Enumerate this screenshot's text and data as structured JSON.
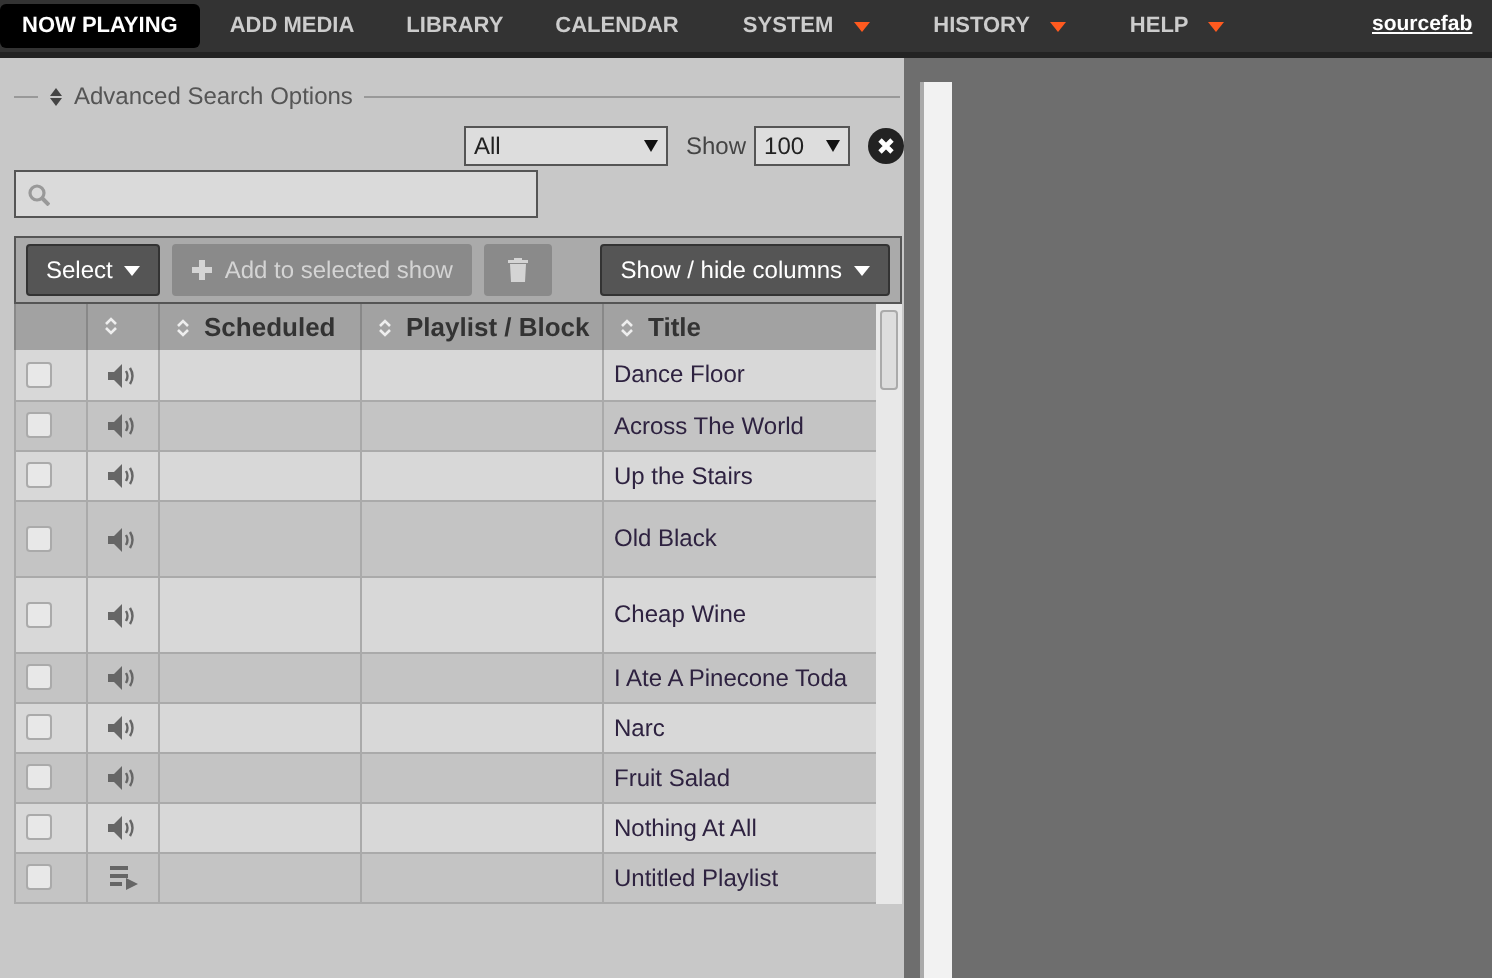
{
  "nav": {
    "items": [
      {
        "label": "NOW PLAYING",
        "selected": true,
        "dropdown": false
      },
      {
        "label": "ADD MEDIA",
        "selected": false,
        "dropdown": false
      },
      {
        "label": "LIBRARY",
        "selected": false,
        "dropdown": false
      },
      {
        "label": "CALENDAR",
        "selected": false,
        "dropdown": false
      },
      {
        "label": "SYSTEM",
        "selected": false,
        "dropdown": true
      },
      {
        "label": "HISTORY",
        "selected": false,
        "dropdown": true
      },
      {
        "label": "HELP",
        "selected": false,
        "dropdown": true
      }
    ],
    "user_link": "sourcefab"
  },
  "advanced_search": {
    "label": "Advanced Search Options"
  },
  "filter": {
    "type_value": "All",
    "show_label": "Show",
    "show_value": "100"
  },
  "toolbar": {
    "buttons": [
      {
        "kind": "menu",
        "label": "Select",
        "disabled": false
      },
      {
        "kind": "add",
        "label": "Add to selected show",
        "disabled": true
      },
      {
        "kind": "trash",
        "disabled": true
      },
      {
        "kind": "menu",
        "label": "Show / hide columns",
        "disabled": false
      }
    ]
  },
  "table": {
    "columns": [
      "Scheduled",
      "Playlist / Block",
      "Title"
    ],
    "rows": [
      {
        "kind": "audio",
        "checked": false,
        "tall": false,
        "title": "Dance Floor"
      },
      {
        "kind": "audio",
        "checked": false,
        "tall": false,
        "title": "Across The World"
      },
      {
        "kind": "audio",
        "checked": false,
        "tall": false,
        "title": "Up the Stairs"
      },
      {
        "kind": "audio",
        "checked": false,
        "tall": true,
        "title": "Old Black"
      },
      {
        "kind": "audio",
        "checked": false,
        "tall": true,
        "title": "Cheap Wine"
      },
      {
        "kind": "audio",
        "checked": false,
        "tall": false,
        "title": "I Ate A Pinecone Toda"
      },
      {
        "kind": "audio",
        "checked": false,
        "tall": false,
        "title": "Narc"
      },
      {
        "kind": "audio",
        "checked": false,
        "tall": false,
        "title": "Fruit Salad"
      },
      {
        "kind": "audio",
        "checked": false,
        "tall": false,
        "title": "Nothing At All"
      },
      {
        "kind": "playlist",
        "checked": false,
        "tall": false,
        "title": "Untitled Playlist"
      }
    ]
  }
}
